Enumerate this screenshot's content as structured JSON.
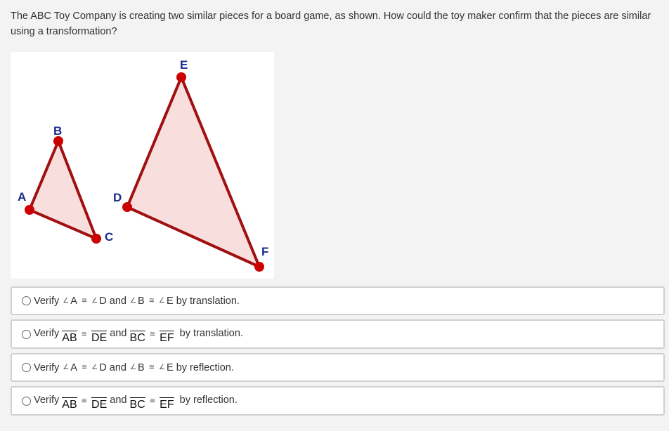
{
  "question": {
    "text": "The ABC Toy Company is creating two similar pieces for a board game, as shown. How could the toy maker confirm that the pieces are similar using a transformation?"
  },
  "figure": {
    "small_triangle": {
      "vertices": [
        {
          "label": "A"
        },
        {
          "label": "B"
        },
        {
          "label": "C"
        }
      ]
    },
    "large_triangle": {
      "vertices": [
        {
          "label": "D"
        },
        {
          "label": "E"
        },
        {
          "label": "F"
        }
      ]
    },
    "colors": {
      "edge": "#a01010",
      "fill": "#f9dede",
      "vertex": "#cc0000",
      "label": "#1a2a8c"
    }
  },
  "symbols": {
    "angle": "∠",
    "congruent": "≅"
  },
  "options": [
    {
      "verify": "Verify",
      "type": "angles",
      "pair1": [
        "A",
        "D"
      ],
      "conj": "and",
      "pair2": [
        "B",
        "E"
      ],
      "method": "by translation."
    },
    {
      "verify": "Verify",
      "type": "segments",
      "pair1": [
        "AB",
        "DE"
      ],
      "conj": "and",
      "pair2": [
        "BC",
        "EF"
      ],
      "method": "by translation."
    },
    {
      "verify": "Verify",
      "type": "angles",
      "pair1": [
        "A",
        "D"
      ],
      "conj": "and",
      "pair2": [
        "B",
        "E"
      ],
      "method": "by reflection."
    },
    {
      "verify": "Verify",
      "type": "segments",
      "pair1": [
        "AB",
        "DE"
      ],
      "conj": "and",
      "pair2": [
        "BC",
        "EF"
      ],
      "method": "by reflection."
    }
  ]
}
